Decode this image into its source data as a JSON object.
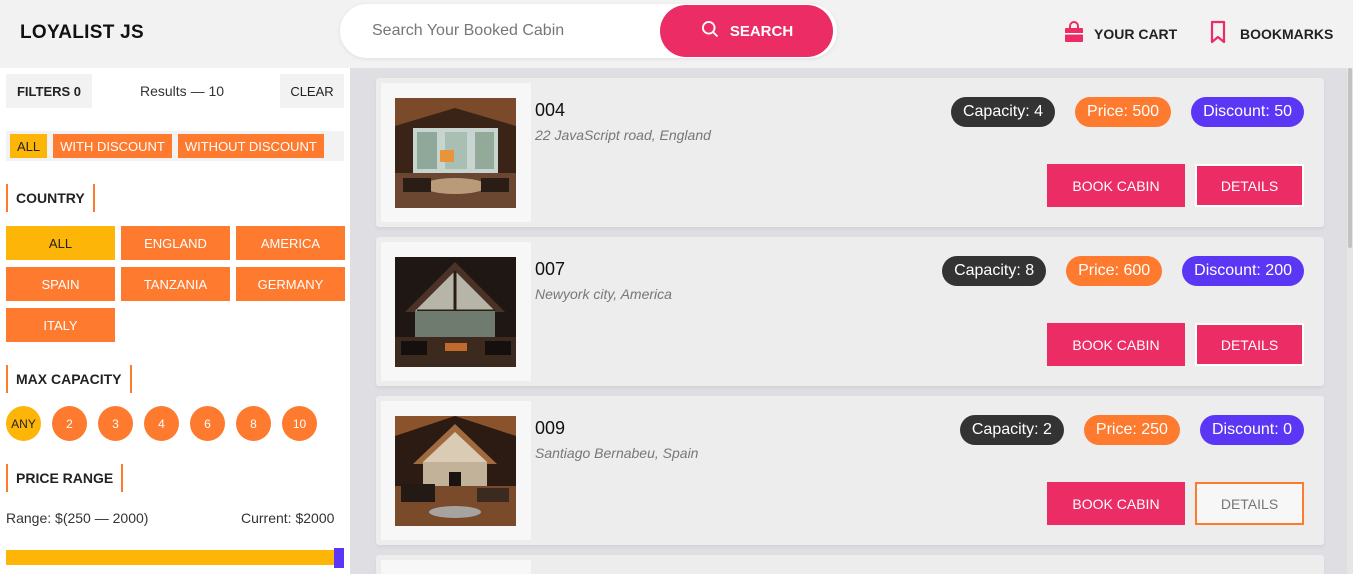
{
  "header": {
    "logo": "LOYALIST JS",
    "search_placeholder": "Search Your Booked Cabin",
    "search_button": "SEARCH",
    "cart": "YOUR CART",
    "bookmarks": "BOOKMARKS"
  },
  "sidebar": {
    "filters_label": "FILTERS 0",
    "results": "Results — 10",
    "clear": "CLEAR",
    "discount_filters": [
      "ALL",
      "WITH DISCOUNT",
      "WITHOUT DISCOUNT"
    ],
    "discount_active": "ALL",
    "country_title": "COUNTRY",
    "countries": [
      "ALL",
      "ENGLAND",
      "AMERICA",
      "SPAIN",
      "TANZANIA",
      "GERMANY",
      "ITALY"
    ],
    "country_active": "ALL",
    "capacity_title": "MAX CAPACITY",
    "capacities": [
      "ANY",
      "2",
      "3",
      "4",
      "6",
      "8",
      "10"
    ],
    "capacity_active": "ANY",
    "price_title": "PRICE RANGE",
    "range_text": "Range: $(250 — 2000)",
    "current_text": "Current: $2000",
    "slider_value_fraction": 1.0
  },
  "cabins": [
    {
      "id": "004",
      "address": "22 JavaScript road, England",
      "capacity": "Capacity: 4",
      "price": "Price: 500",
      "discount": "Discount: 50",
      "book": "BOOK CABIN",
      "details": "DETAILS"
    },
    {
      "id": "007",
      "address": "Newyork city, America",
      "capacity": "Capacity: 8",
      "price": "Price: 600",
      "discount": "Discount: 200",
      "book": "BOOK CABIN",
      "details": "DETAILS"
    },
    {
      "id": "009",
      "address": "Santiago Bernabeu, Spain",
      "capacity": "Capacity: 2",
      "price": "Price: 250",
      "discount": "Discount: 0",
      "book": "BOOK CABIN",
      "details": "DETAILS"
    }
  ],
  "colors": {
    "accent_pink": "#ec2c65",
    "accent_orange": "#fd7a2e",
    "accent_yellow": "#fdb507",
    "accent_purple": "#5b37f5"
  }
}
